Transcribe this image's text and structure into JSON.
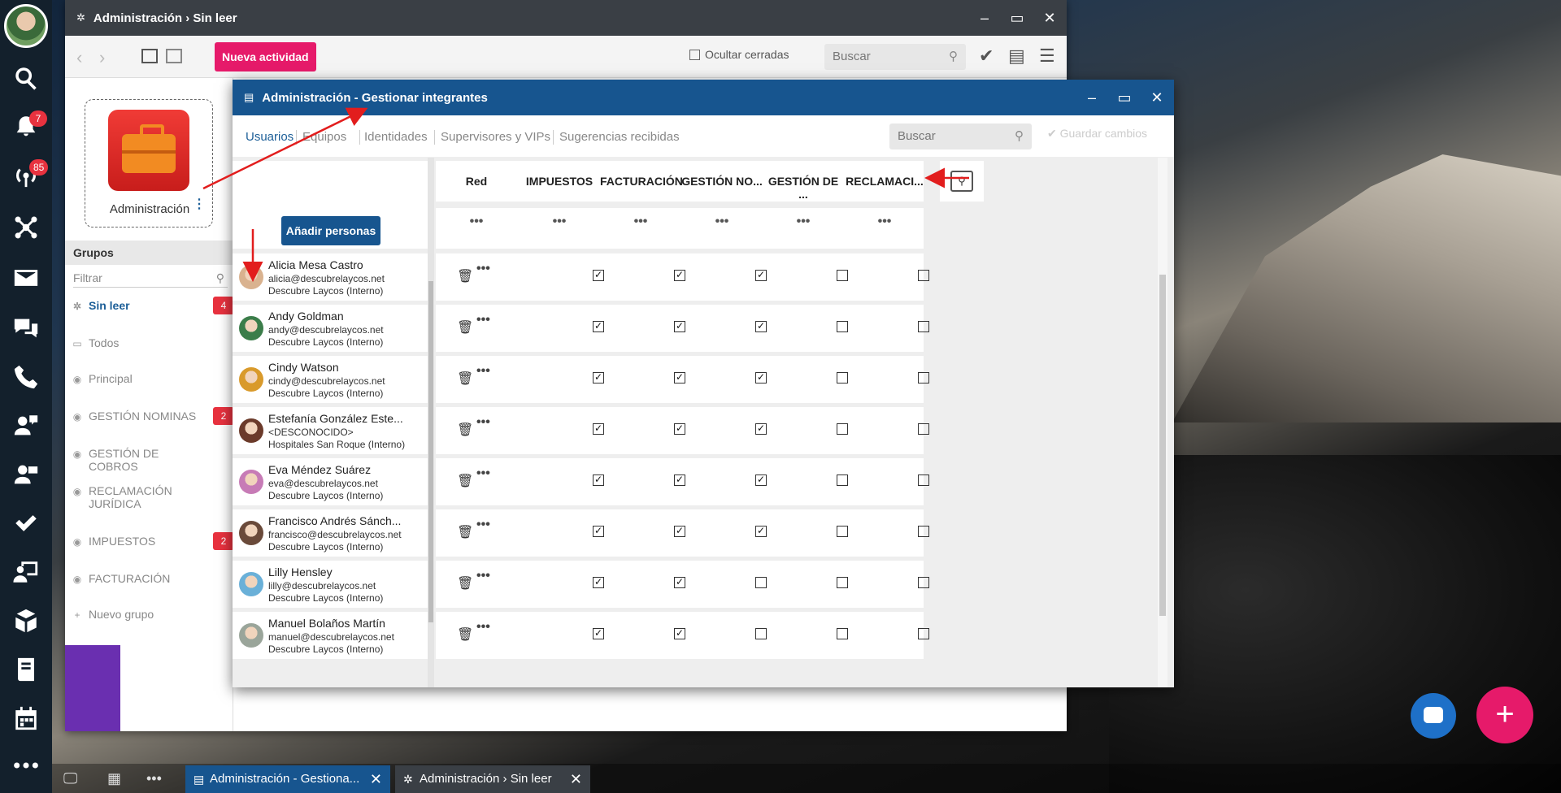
{
  "back_window": {
    "title": "Administración › Sin leer",
    "new_activity": "Nueva actividad",
    "hide_closed": "Ocultar cerradas",
    "search_placeholder": "Buscar",
    "app_name": "Administración",
    "groups_label": "Grupos",
    "filter_placeholder": "Filtrar",
    "groups": [
      {
        "label": "Sin leer",
        "badge": "4",
        "icon": "sun-icon"
      },
      {
        "label": "Todos",
        "badge": "",
        "icon": "inbox-icon"
      },
      {
        "label": "Principal",
        "badge": "",
        "icon": "radio-icon"
      },
      {
        "label": "GESTIÓN NOMINAS",
        "badge": "2",
        "icon": "radio-icon"
      },
      {
        "label": "GESTIÓN DE COBROS",
        "badge": "",
        "icon": "radio-icon"
      },
      {
        "label": "RECLAMACIÓN JURÍDICA",
        "badge": "",
        "icon": "radio-icon"
      },
      {
        "label": "IMPUESTOS",
        "badge": "2",
        "icon": "radio-icon"
      },
      {
        "label": "FACTURACIÓN",
        "badge": "",
        "icon": "radio-icon"
      },
      {
        "label": "Nuevo grupo",
        "badge": "",
        "icon": "plus-icon"
      }
    ]
  },
  "dialog": {
    "title": "Administración - Gestionar integrantes",
    "tabs": [
      "Usuarios",
      "Equipos",
      "Identidades",
      "Supervisores y VIPs",
      "Sugerencias recibidas"
    ],
    "search_placeholder": "Buscar",
    "save_label": "Guardar cambios",
    "add_people": "Añadir personas",
    "columns": [
      "Red",
      "IMPUESTOS",
      "FACTURACIÓN",
      "GESTIÓN NO...",
      "GESTIÓN DE ...",
      "RECLAMACI..."
    ],
    "column_dots": "•••",
    "members": [
      {
        "name": "Alicia Mesa Castro",
        "email": "alicia@descubrelaycos.net",
        "org": "Descubre Laycos (Interno)",
        "checks": [
          true,
          true,
          true,
          false,
          false
        ]
      },
      {
        "name": "Andy Goldman",
        "email": "andy@descubrelaycos.net",
        "org": "Descubre Laycos (Interno)",
        "checks": [
          true,
          true,
          true,
          false,
          false
        ]
      },
      {
        "name": "Cindy Watson",
        "email": "cindy@descubrelaycos.net",
        "org": "Descubre Laycos (Interno)",
        "checks": [
          true,
          true,
          true,
          false,
          false
        ]
      },
      {
        "name": "Estefanía González Este...",
        "email": "<DESCONOCIDO>",
        "org": "Hospitales San Roque (Interno)",
        "checks": [
          true,
          true,
          true,
          false,
          false
        ]
      },
      {
        "name": "Eva Méndez Suárez",
        "email": "eva@descubrelaycos.net",
        "org": "Descubre Laycos (Interno)",
        "checks": [
          true,
          true,
          true,
          false,
          false
        ]
      },
      {
        "name": "Francisco Andrés Sánch...",
        "email": "francisco@descubrelaycos.net",
        "org": "Descubre Laycos (Interno)",
        "checks": [
          true,
          true,
          true,
          false,
          false
        ]
      },
      {
        "name": "Lilly Hensley",
        "email": "lilly@descubrelaycos.net",
        "org": "Descubre Laycos (Interno)",
        "checks": [
          true,
          true,
          false,
          false,
          false
        ]
      },
      {
        "name": "Manuel Bolaños Martín",
        "email": "manuel@descubrelaycos.net",
        "org": "Descubre Laycos (Interno)",
        "checks": [
          true,
          true,
          false,
          false,
          false
        ]
      }
    ]
  },
  "dock": {
    "notifications_badge": "7",
    "signal_badge": "85"
  },
  "taskbar": {
    "task1": "Administración - Gestiona...",
    "task2": "Administración › Sin leer"
  }
}
